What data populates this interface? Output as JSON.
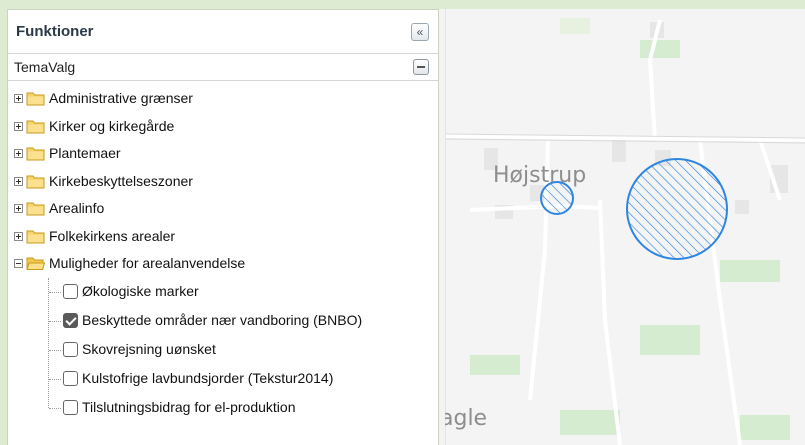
{
  "panel": {
    "title": "Funktioner",
    "collapse_icon": "double-chevron-left-icon",
    "tema": {
      "label": "TemaValg",
      "collapse_icon": "minus-icon"
    },
    "folders": [
      {
        "label": "Administrative grænser",
        "expanded": false
      },
      {
        "label": "Kirker og kirkegårde",
        "expanded": false
      },
      {
        "label": "Plantemaer",
        "expanded": false
      },
      {
        "label": "Kirkebeskyttelseszoner",
        "expanded": false
      },
      {
        "label": "Arealinfo",
        "expanded": false
      },
      {
        "label": "Folkekirkens arealer",
        "expanded": false
      },
      {
        "label": "Muligheder for arealanvendelse",
        "expanded": true
      }
    ],
    "layers": [
      {
        "label": "Økologiske marker",
        "checked": false
      },
      {
        "label": "Beskyttede områder nær vandboring (BNBO)",
        "checked": true
      },
      {
        "label": "Skovrejsning uønsket",
        "checked": false
      },
      {
        "label": "Kulstofrige lavbundsjorder (Tekstur2014)",
        "checked": false
      },
      {
        "label": "Tilslutningsbidrag for el-produktion",
        "checked": false
      }
    ]
  },
  "map": {
    "place_label": "Højstrup",
    "partial_label": "agle",
    "colors": {
      "background": "#dcebd2",
      "map_bg": "#f4f4f4",
      "road": "#ffffff",
      "green": "#d6ecd0",
      "bnbo": "#2f86e0"
    }
  }
}
